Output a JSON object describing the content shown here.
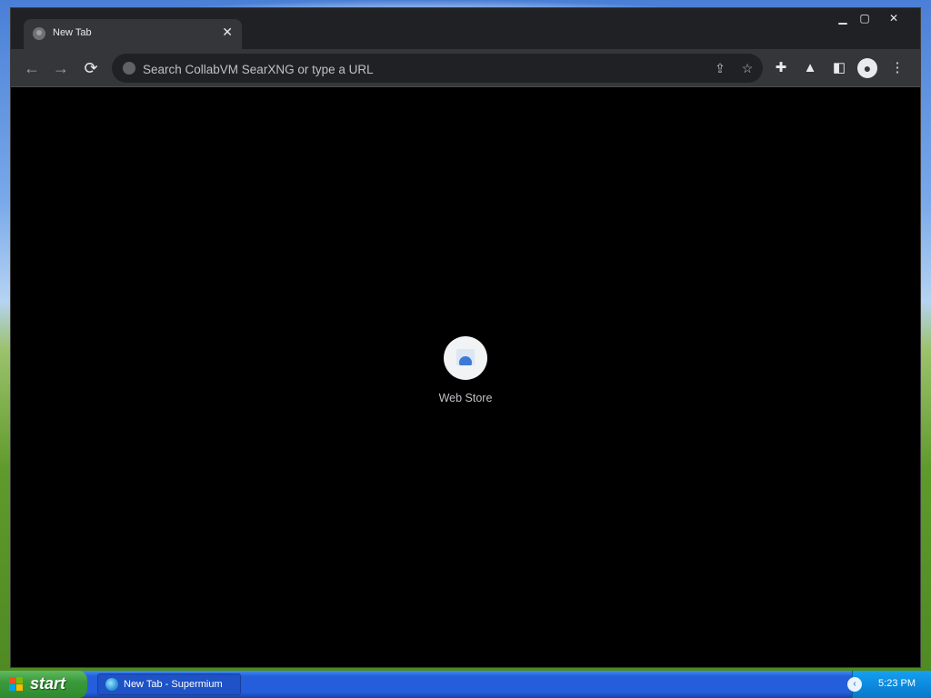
{
  "browser": {
    "tab": {
      "title": "New Tab"
    },
    "omnibox": {
      "placeholder": "Search CollabVM SearXNG or type a URL",
      "value": ""
    },
    "shortcuts": [
      {
        "label": "Web Store"
      }
    ]
  },
  "taskbar": {
    "start_label": "start",
    "items": [
      {
        "label": "New Tab - Supermium"
      }
    ],
    "clock": "5:23 PM"
  },
  "colors": {
    "browser_frame": "#202124",
    "toolbar": "#35363a",
    "content": "#000000",
    "taskbar": "#245edb",
    "start_button": "#3b9a3b"
  }
}
